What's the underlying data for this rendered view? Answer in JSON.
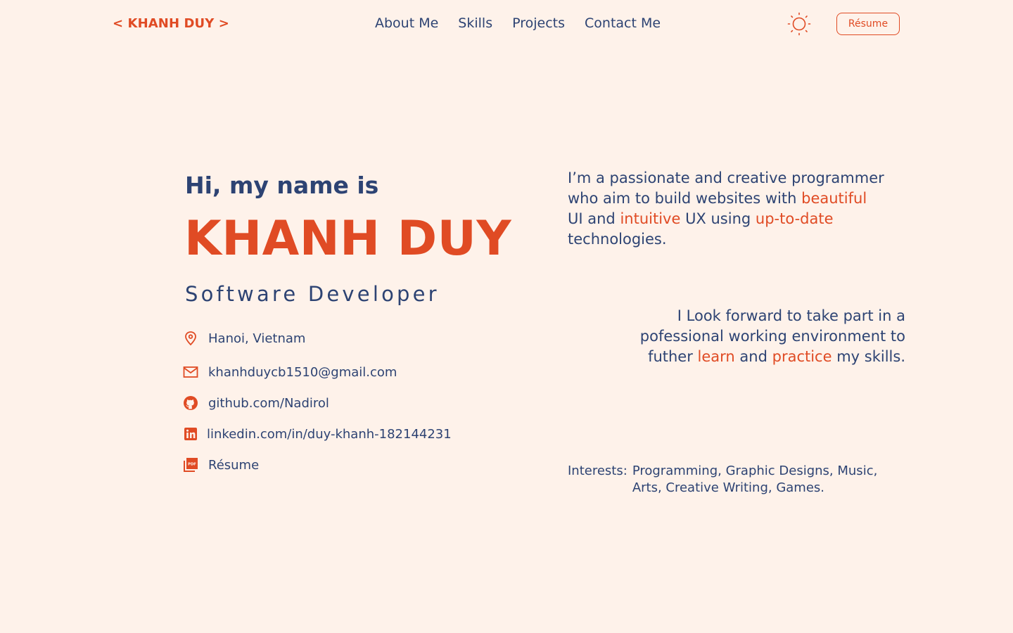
{
  "header": {
    "brand": "< KHANH DUY >",
    "nav": [
      "About Me",
      "Skills",
      "Projects",
      "Contact Me"
    ],
    "resume_button": "Résume"
  },
  "hero": {
    "greeting": "Hi, my name is",
    "name": "KHANH DUY",
    "role": "Software Developer"
  },
  "contacts": [
    {
      "icon": "location-pin-icon",
      "text": "Hanoi, Vietnam"
    },
    {
      "icon": "mail-icon",
      "text": "khanhduycb1510@gmail.com"
    },
    {
      "icon": "github-icon",
      "text": "github.com/Nadirol"
    },
    {
      "icon": "linkedin-icon",
      "text": "linkedin.com/in/duy-khanh-182144231"
    },
    {
      "icon": "pdf-icon",
      "text": "Résume"
    }
  ],
  "intro": {
    "p1": "I’m a passionate and creative programmer who aim to build websites with ",
    "h1": "beautiful",
    "p2": " UI and ",
    "h2": "intuitive",
    "p3": " UX using ",
    "h3": "up-to-date",
    "p4": " technologies."
  },
  "goal": {
    "p1": "I Look forward to take part in a pofessional working environment to futher ",
    "h1": "learn",
    "p2": " and ",
    "h2": "practice",
    "p3": " my skills."
  },
  "interests": {
    "label": "Interests:",
    "value": "Programming, Graphic Designs, Music, Arts,  Creative Writing, Games."
  },
  "colors": {
    "background": "#fef2ea",
    "accent": "#e04b24",
    "text": "#2d4373"
  }
}
